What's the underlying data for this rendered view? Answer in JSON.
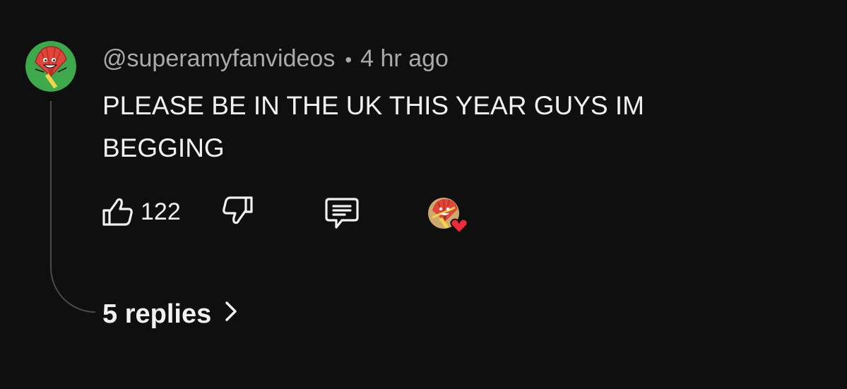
{
  "comment": {
    "author": "@superamyfanvideos",
    "separator": "•",
    "timestamp": "4 hr ago",
    "text": "PLEASE BE IN THE UK THIS YEAR GUYS IM BEGGING",
    "like_count": "122",
    "avatar_icon": "fan-character-avatar-icon",
    "creator_heart_icon": "creator-heart-icon"
  },
  "replies": {
    "label": "5 replies",
    "icon": "chevron-right-icon"
  },
  "colors": {
    "background": "#0f0f0f",
    "primary_text": "#f1f1f1",
    "secondary_text": "#aaaaaa",
    "avatar_bg": "#3da94a",
    "fan_red": "#e0453a",
    "heart_red": "#ee2b36"
  }
}
